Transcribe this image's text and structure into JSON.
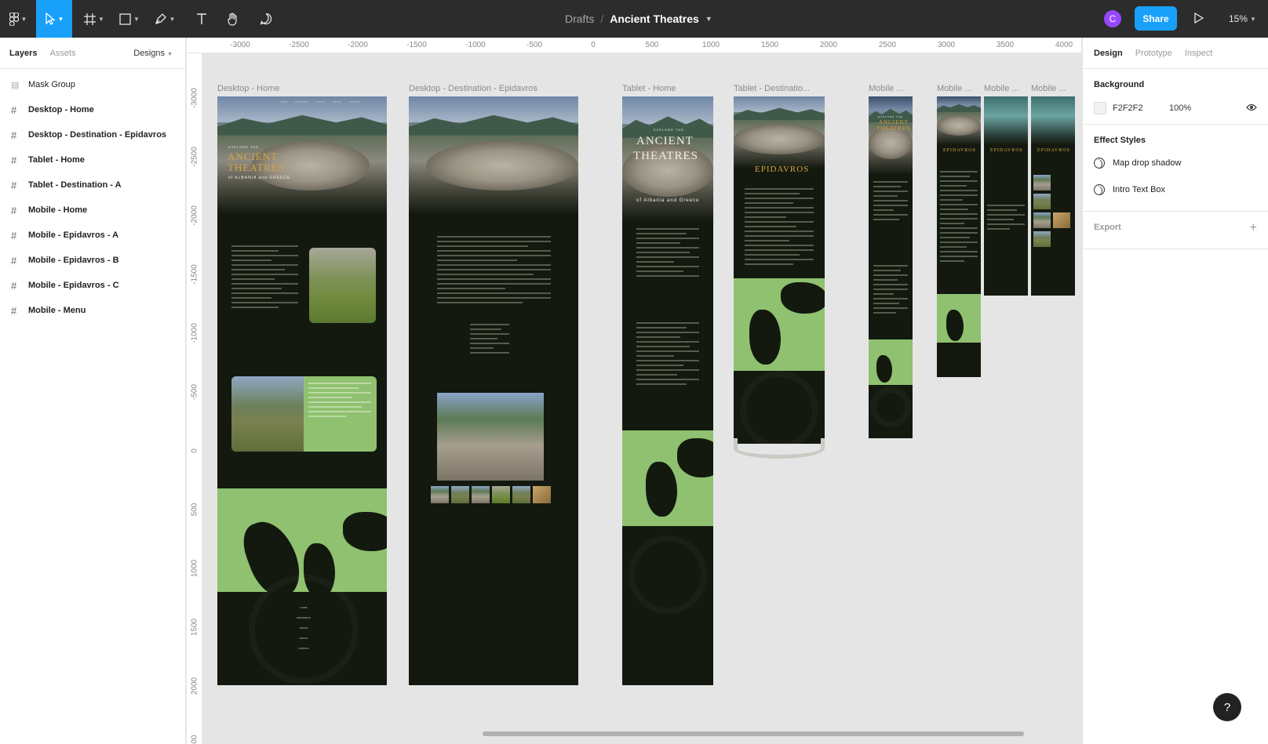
{
  "topbar": {
    "breadcrumb": "Drafts",
    "separator": "/",
    "file_name": "Ancient Theatres",
    "avatar_initial": "C",
    "share_label": "Share",
    "zoom": "15%"
  },
  "left_panel": {
    "tabs": [
      "Layers",
      "Assets"
    ],
    "pages_label": "Designs",
    "layers": [
      {
        "name": "Mask Group",
        "icon": "mask-group-icon",
        "bold": false
      },
      {
        "name": "Desktop - Home",
        "icon": "frame-icon",
        "bold": true
      },
      {
        "name": "Desktop - Destination - Epidavros",
        "icon": "frame-icon",
        "bold": true
      },
      {
        "name": "Tablet - Home",
        "icon": "frame-icon",
        "bold": true
      },
      {
        "name": "Tablet - Destination - A",
        "icon": "frame-icon",
        "bold": true
      },
      {
        "name": "Mobile - Home",
        "icon": "frame-icon",
        "bold": true
      },
      {
        "name": "Mobile - Epidavros - A",
        "icon": "frame-icon",
        "bold": true
      },
      {
        "name": "Mobile - Epidavros - B",
        "icon": "frame-icon",
        "bold": true
      },
      {
        "name": "Mobile - Epidavros - C",
        "icon": "frame-icon",
        "bold": true
      },
      {
        "name": "Mobile - Menu",
        "icon": "frame-icon",
        "bold": true
      }
    ]
  },
  "rulers": {
    "horizontal": [
      "-3000",
      "-2500",
      "-2000",
      "-1500",
      "-1000",
      "-500",
      "0",
      "500",
      "1000",
      "1500",
      "2000",
      "2500",
      "3000",
      "3500",
      "4000"
    ],
    "vertical": [
      "-3000",
      "-2500",
      "-2000",
      "-1500",
      "-1000",
      "-500",
      "0",
      "500",
      "1000",
      "1500",
      "2000",
      "00"
    ]
  },
  "frames": {
    "desktop_home": {
      "label": "Desktop - Home",
      "explore": "EXPLORE THE",
      "title_line1": "ANCIENT",
      "title_line2": "THEATRES",
      "subtitle": "of ALBANIA and GREECE",
      "nav": [
        "HOME",
        "EPIDAVROS",
        "ARGOS",
        "DELPHI",
        "DODONA"
      ]
    },
    "desktop_epidavros": {
      "label": "Desktop - Destination - Epidavros"
    },
    "tablet_home": {
      "label": "Tablet - Home",
      "explore": "EXPLORE THE",
      "title_line1": "ANCIENT",
      "title_line2": "THEATRES",
      "subtitle": "of Albania and Greece"
    },
    "tablet_destination": {
      "label": "Tablet - Destinatio...",
      "title": "EPIDAVROS"
    },
    "mobile_home": {
      "label": "Mobile ...",
      "explore": "EXPLORE THE",
      "title_line1": "ANCIENT",
      "title_line2": "THEATRES"
    },
    "mobile_a": {
      "label": "Mobile ...",
      "title": "EPIDAVROS"
    },
    "mobile_b": {
      "label": "Mobile ...",
      "title": "EPIDAVROS"
    },
    "mobile_c": {
      "label": "Mobile ...",
      "title": "EPIDAVROS"
    }
  },
  "right_panel": {
    "tabs": [
      "Design",
      "Prototype",
      "Inspect"
    ],
    "background_heading": "Background",
    "background_hex": "F2F2F2",
    "background_opacity": "100%",
    "effect_styles_heading": "Effect Styles",
    "effect_styles": [
      "Map drop shadow",
      "Intro Text Box"
    ],
    "export_heading": "Export"
  },
  "help_label": "?",
  "colors": {
    "accent": "#18a0fb",
    "toolbar": "#2c2c2c",
    "frame_bg": "#13190f",
    "map_green": "#8fc170",
    "title_gold": "#d9a441",
    "avatar": "#9747ff"
  }
}
